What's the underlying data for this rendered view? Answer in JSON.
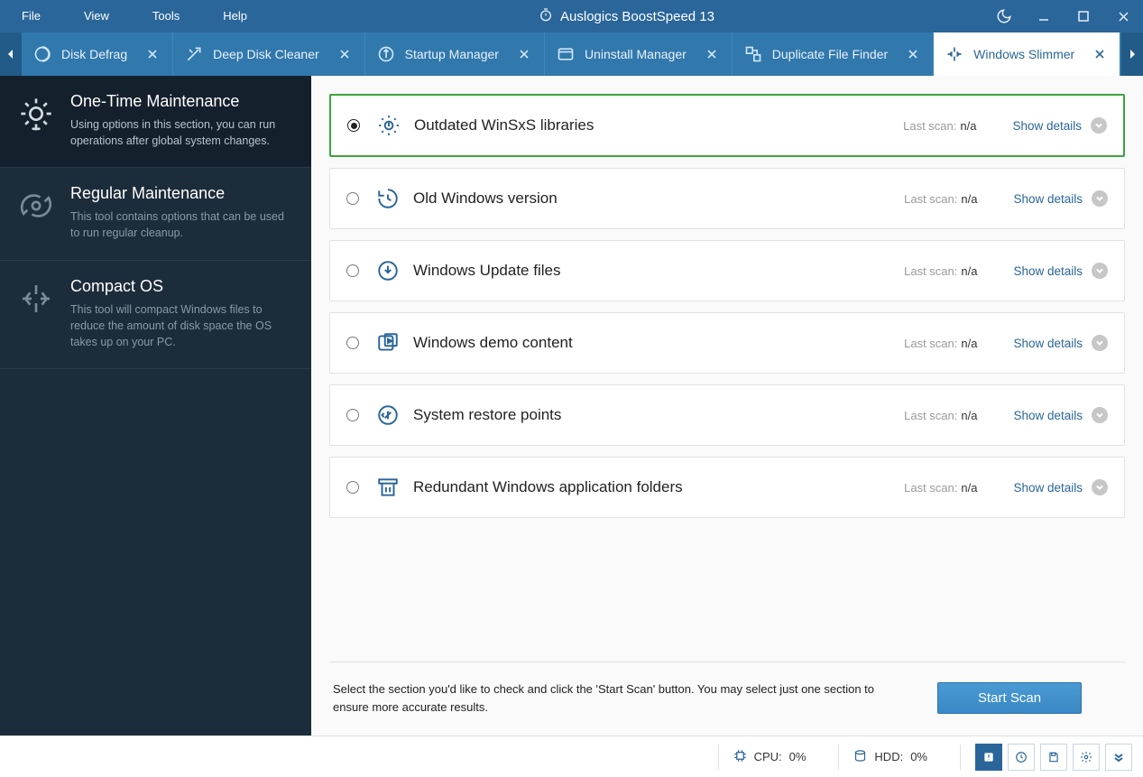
{
  "app_title": "Auslogics BoostSpeed 13",
  "menu": {
    "file": "File",
    "view": "View",
    "tools": "Tools",
    "help": "Help"
  },
  "tabs": [
    {
      "label": "Disk Defrag",
      "active": false
    },
    {
      "label": "Deep Disk Cleaner",
      "active": false
    },
    {
      "label": "Startup Manager",
      "active": false
    },
    {
      "label": "Uninstall Manager",
      "active": false
    },
    {
      "label": "Duplicate File Finder",
      "active": false
    },
    {
      "label": "Windows Slimmer",
      "active": true
    }
  ],
  "sidebar": [
    {
      "title": "One-Time Maintenance",
      "desc": "Using options in this section, you can run operations after global system changes.",
      "active": true
    },
    {
      "title": "Regular Maintenance",
      "desc": "This tool contains options that can be used to run regular cleanup.",
      "active": false
    },
    {
      "title": "Compact OS",
      "desc": "This tool will compact Windows files to reduce the amount of disk space the OS takes up on your PC.",
      "active": false
    }
  ],
  "last_scan_label": "Last scan:",
  "show_details": "Show details",
  "cards": [
    {
      "title": "Outdated WinSxS libraries",
      "last_scan": "n/a",
      "selected": true
    },
    {
      "title": "Old Windows version",
      "last_scan": "n/a",
      "selected": false
    },
    {
      "title": "Windows Update files",
      "last_scan": "n/a",
      "selected": false
    },
    {
      "title": "Windows demo content",
      "last_scan": "n/a",
      "selected": false
    },
    {
      "title": "System restore points",
      "last_scan": "n/a",
      "selected": false
    },
    {
      "title": "Redundant Windows application folders",
      "last_scan": "n/a",
      "selected": false
    }
  ],
  "footer_hint": "Select the section you'd like to check and click the 'Start Scan' button. You may select just one section to ensure more accurate results.",
  "start_scan": "Start Scan",
  "status": {
    "cpu_label": "CPU:",
    "cpu_value": "0%",
    "hdd_label": "HDD:",
    "hdd_value": "0%"
  }
}
